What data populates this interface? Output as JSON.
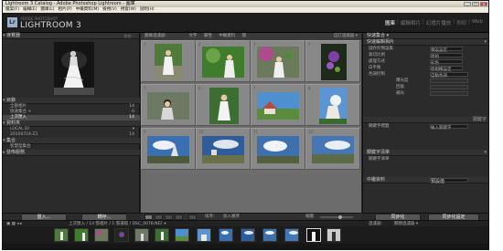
{
  "window": {
    "title": "Lightroom 3 Catalog - Adobe Photoshop Lightroom - 圖庫",
    "controls": [
      "_",
      "□",
      "×"
    ]
  },
  "menu": [
    "檔案(F)",
    "編輯(E)",
    "圖庫(L)",
    "相片(P)",
    "中繼資料(M)",
    "檢視(V)",
    "視窗(W)",
    "說明(H)"
  ],
  "identity": {
    "badge": "Lr",
    "sub": "ADOBE PHOTOSHOP",
    "name": "LIGHTROOM 3",
    "modules": [
      "圖庫",
      "編輯相片",
      "幻燈片播放",
      "列印",
      "Web"
    ],
    "active_module": "圖庫"
  },
  "left_panel": {
    "navigator_label": "導覽器",
    "navigator_zoom": "符合 ·",
    "catalog_label": "目錄",
    "catalog_rows": [
      {
        "label": "全部相片",
        "count": "14"
      },
      {
        "label": "快速集合 +",
        "count": "0"
      },
      {
        "label": "上次匯入",
        "count": "14",
        "selected": true
      }
    ],
    "folders_label": "資料夾",
    "folder_rows": [
      {
        "label": "LOCAL DI",
        "count": "▾"
      },
      {
        "label": "20100724-Z1",
        "count": "14"
      }
    ],
    "collections_label": "集合",
    "collection_rows": [
      {
        "label": "智慧型集合",
        "count": ""
      }
    ],
    "publish_label": "發佈服務",
    "import_button": "匯入...",
    "export_button": "轉存..."
  },
  "grid": {
    "filter_label": "圖庫過濾器：",
    "filter_options": [
      "文字",
      "屬性",
      "中繼資料",
      "無"
    ],
    "filter_preset": "自訂過濾器 ▾",
    "thumb_numbers": [
      "1",
      "2",
      "3",
      "4",
      "5",
      "6",
      "7",
      "8",
      "9",
      "10",
      "11",
      "12"
    ]
  },
  "right_panel": {
    "histogram_label": "快速集合 ▾",
    "quick_develop_label": "快速編輯相片",
    "rows": [
      {
        "label": "儲存的預設集",
        "value": "預設設定"
      },
      {
        "label": "裁切比例",
        "value": "原始"
      },
      {
        "label": "處理方式",
        "value": "彩色"
      },
      {
        "label": "白平衡",
        "value": "原相機設定"
      },
      {
        "label": "色調控制",
        "value": "自動色調"
      },
      {
        "label": "曝光度",
        "value": ""
      },
      {
        "label": "回復",
        "value": ""
      },
      {
        "label": "補光",
        "value": ""
      }
    ],
    "keywording_label": "關鍵字",
    "keyword_tags_label": "關鍵字標籤",
    "keyword_input": "輸入關鍵字",
    "keyword_list_label": "關鍵字清單",
    "metadata_label": "中繼資料",
    "default_label": "預設值",
    "sync_button": "同步化",
    "sync_settings_button": "同步化設定"
  },
  "toolbar": {
    "sort_label": "排序：",
    "sort_value": "加入順序",
    "thumbnails_label": "縮圖"
  },
  "filmstrip": {
    "header": "上次匯入 / 14 張相片 / 1 張選取 / DSC_0078.NEF ▾",
    "filter_label": "過濾器：",
    "filter_value": "關閉過濾器 ▾"
  },
  "colors": {
    "panel": "#2b2b2b",
    "grid": "#6c6c6c",
    "accent": "#ffffff"
  }
}
